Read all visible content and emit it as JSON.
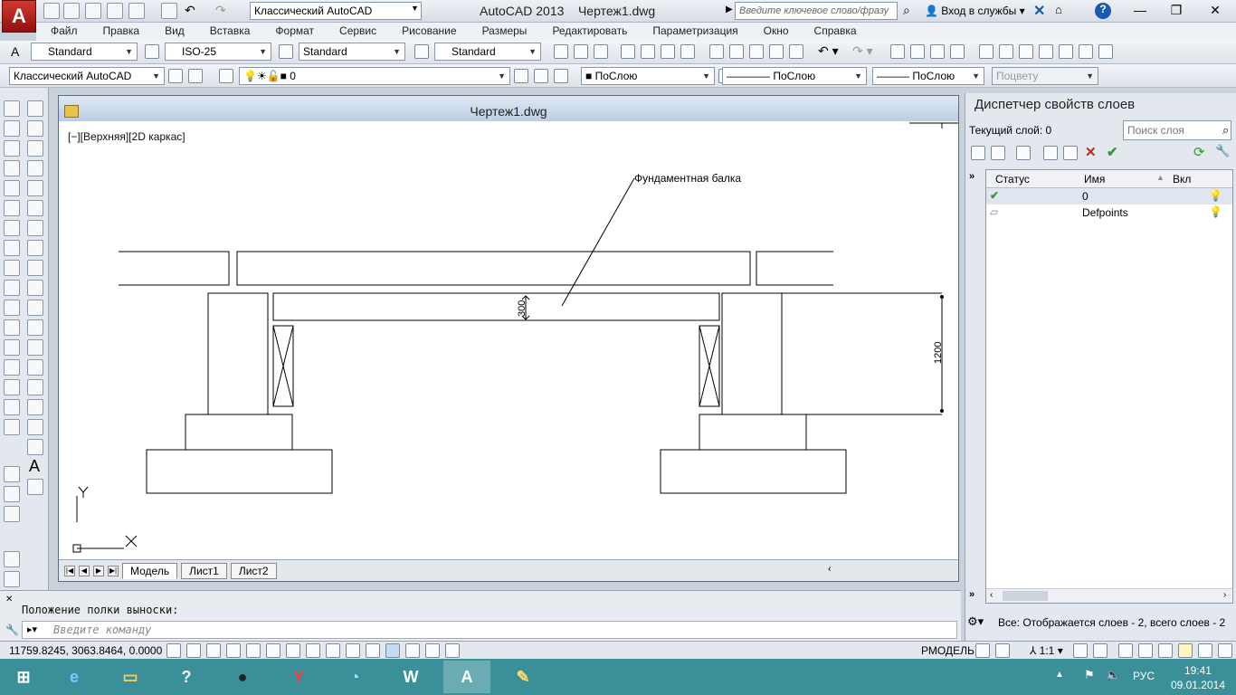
{
  "app": {
    "title": "AutoCAD 2013",
    "file": "Чертеж1.dwg",
    "workspace": "Классический AutoCAD",
    "search_placeholder": "Введите ключевое слово/фразу",
    "login": "Вход в службы"
  },
  "menu": [
    "Файл",
    "Правка",
    "Вид",
    "Вставка",
    "Формат",
    "Сервис",
    "Рисование",
    "Размеры",
    "Редактировать",
    "Параметризация",
    "Окно",
    "Справка"
  ],
  "styles": {
    "text_style": "Standard",
    "dim_style": "ISO-25",
    "table_style": "Standard",
    "mleader_style": "Standard"
  },
  "layers_toolbar": {
    "workspace": "Классический AutoCAD",
    "layer": "0",
    "color": "ПоСлою",
    "linetype": "ПоСлою",
    "lineweight": "ПоСлою",
    "plotstyle": "Поцвету"
  },
  "drawing": {
    "window_title": "Чертеж1.dwg",
    "view_label": "[−][Верхняя][2D каркас]",
    "annotation": "Фундаментная балка",
    "dim1": "300",
    "dim2": "1200",
    "ucs_x": "X",
    "ucs_y": "Y",
    "tabs": [
      "Модель",
      "Лист1",
      "Лист2"
    ]
  },
  "command": {
    "history": "Положение полки выноски:",
    "placeholder": "Введите команду"
  },
  "layer_panel": {
    "title": "Диспетчер свойств слоев",
    "current_layer": "Текущий слой: 0",
    "search_placeholder": "Поиск слоя",
    "columns": [
      "Статус",
      "Имя",
      "Вкл"
    ],
    "rows": [
      {
        "name": "0"
      },
      {
        "name": "Defpoints"
      }
    ],
    "status": "Все: Отображается слоев - 2, всего слоев - 2"
  },
  "statusbar": {
    "coords": "11759.8245, 3063.8464, 0.0000",
    "model": "РМОДЕЛЬ",
    "scale": "1:1"
  },
  "taskbar": {
    "lang": "РУС",
    "time": "19:41",
    "date": "09.01.2014"
  },
  "colors": {
    "accent": "#3a8f98",
    "autocad_red": "#c0271b",
    "ok_green": "#2e9a2e"
  }
}
